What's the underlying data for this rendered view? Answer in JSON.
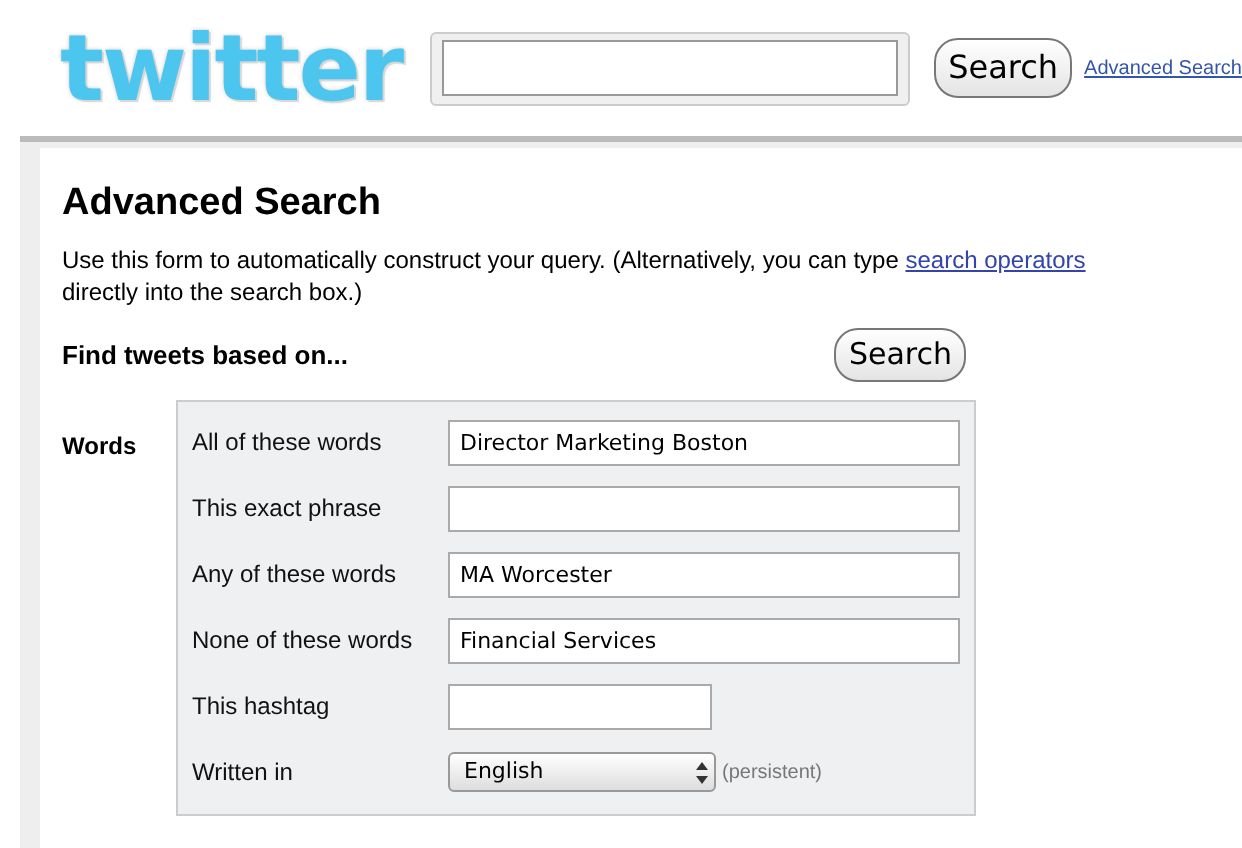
{
  "header": {
    "logo": "twitter",
    "search": {
      "button": "Search"
    },
    "advanced_link": "Advanced Search"
  },
  "title": "Advanced Search",
  "intro": {
    "before": "Use this form to automatically construct your query. (Alternatively, you can type ",
    "link": "search operators",
    "after": " directly into the search box.)"
  },
  "section": {
    "heading": "Find tweets based on...",
    "button": "Search"
  },
  "group": {
    "label": "Words",
    "fields": [
      {
        "kind": "text",
        "label": "All of these words",
        "value": "Director Marketing Boston"
      },
      {
        "kind": "text",
        "label": "This exact phrase"
      },
      {
        "kind": "text",
        "label": "Any of these words",
        "value": "MA Worcester"
      },
      {
        "kind": "text",
        "label": "None of these words",
        "value": "Financial Services"
      },
      {
        "kind": "short",
        "label": "This hashtag"
      },
      {
        "kind": "select",
        "label": "Written in",
        "value": "English",
        "note": "(persistent)"
      }
    ]
  }
}
